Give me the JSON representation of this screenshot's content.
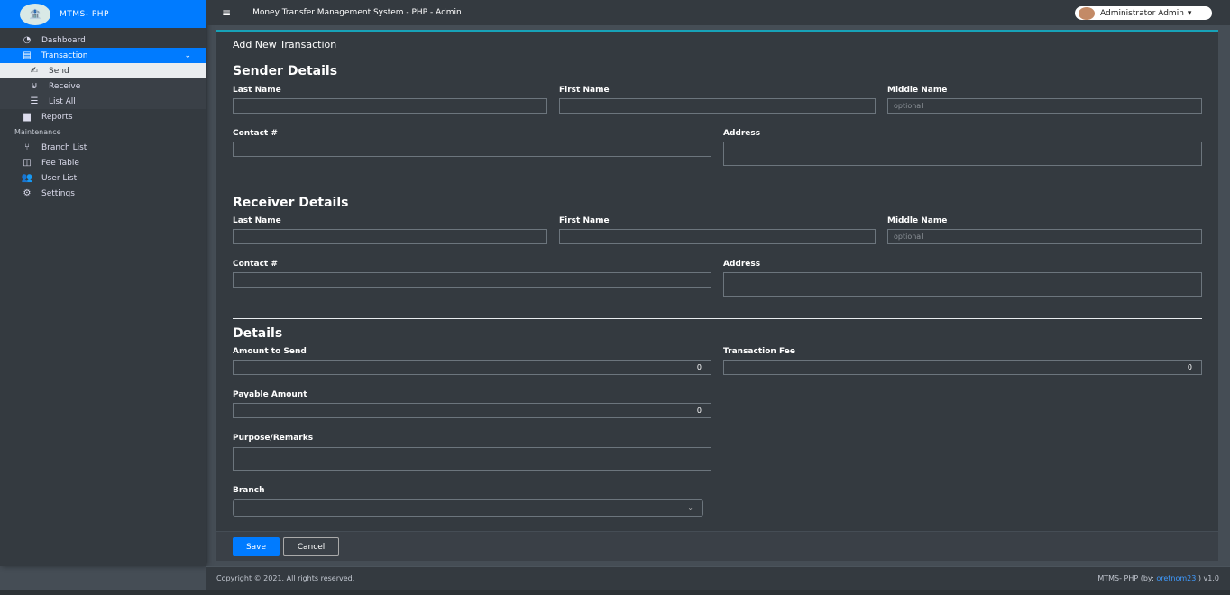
{
  "brand": {
    "name": "MTMS- PHP",
    "logo_icon": "bank-logo"
  },
  "topbar": {
    "title": "Money Transfer Management System - PHP - Admin",
    "user_name": "Administrator Admin"
  },
  "sidebar": {
    "dashboard": "Dashboard",
    "transaction": "Transaction",
    "send": "Send",
    "receive": "Receive",
    "list_all": "List All",
    "reports": "Reports",
    "maintenance_header": "Maintenance",
    "branch_list": "Branch List",
    "fee_table": "Fee Table",
    "user_list": "User List",
    "settings": "Settings"
  },
  "form": {
    "card_title": "Add New Transaction",
    "sender_title": "Sender Details",
    "receiver_title": "Receiver Details",
    "details_title": "Details",
    "last_name": "Last Name",
    "first_name": "First Name",
    "middle_name": "Middle Name",
    "middle_placeholder": "optional",
    "contact": "Contact #",
    "address": "Address",
    "amount_label": "Amount to Send",
    "amount_value": "0",
    "fee_label": "Transaction Fee",
    "fee_value": "0",
    "payable_label": "Payable Amount",
    "payable_value": "0",
    "purpose_label": "Purpose/Remarks",
    "branch_label": "Branch",
    "save": "Save",
    "cancel": "Cancel"
  },
  "footer": {
    "copyright": "Copyright © 2021. All rights reserved.",
    "version_prefix": "MTMS- PHP (by: ",
    "author": "oretnom23",
    "version_suffix": " ) v1.0"
  },
  "colors": {
    "accent": "#007bff",
    "card_top": "#17a2b8",
    "bg": "#454d55",
    "panel": "#343a40"
  }
}
